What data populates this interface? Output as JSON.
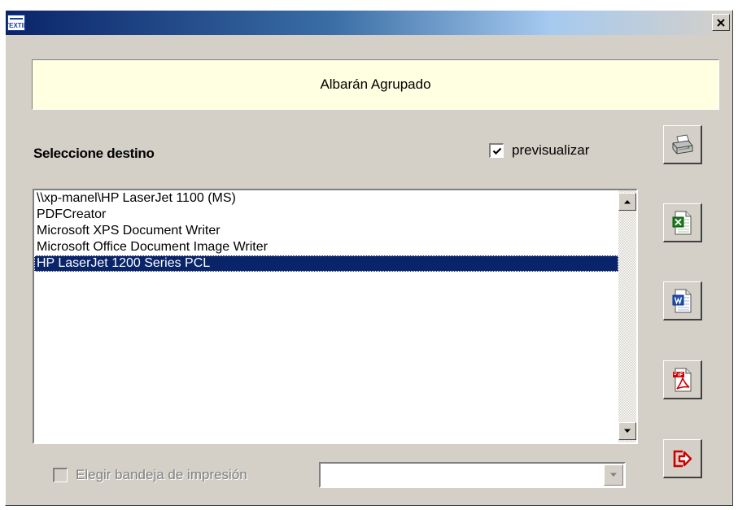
{
  "window": {
    "title": "",
    "close_label": "×",
    "app_icon": "app-logo-icon"
  },
  "header": {
    "title": "Albarán Agrupado"
  },
  "destination": {
    "label": "Seleccione destino",
    "preview_label": "previsualizar",
    "preview_checked": true
  },
  "printers": {
    "items": [
      "\\\\xp-manel\\HP LaserJet 1100 (MS)",
      "PDFCreator",
      "Microsoft XPS Document Writer",
      "Microsoft Office Document Image Writer",
      "HP LaserJet 1200 Series PCL"
    ],
    "selected_index": 4
  },
  "side_buttons": [
    {
      "name": "print-button",
      "icon": "printer-icon"
    },
    {
      "name": "export-excel-button",
      "icon": "excel-icon"
    },
    {
      "name": "export-word-button",
      "icon": "word-icon"
    },
    {
      "name": "export-pdf-button",
      "icon": "pdf-icon"
    },
    {
      "name": "exit-button",
      "icon": "exit-icon"
    }
  ],
  "tray": {
    "label": "Elegir bandeja de impresión",
    "checked": false,
    "enabled": false,
    "selected_value": ""
  },
  "colors": {
    "title_gradient_start": "#0a246a",
    "selection": "#0a246a",
    "header_bg": "#ffffe1",
    "face": "#d4d0c8",
    "exit_red": "#cc0000"
  }
}
